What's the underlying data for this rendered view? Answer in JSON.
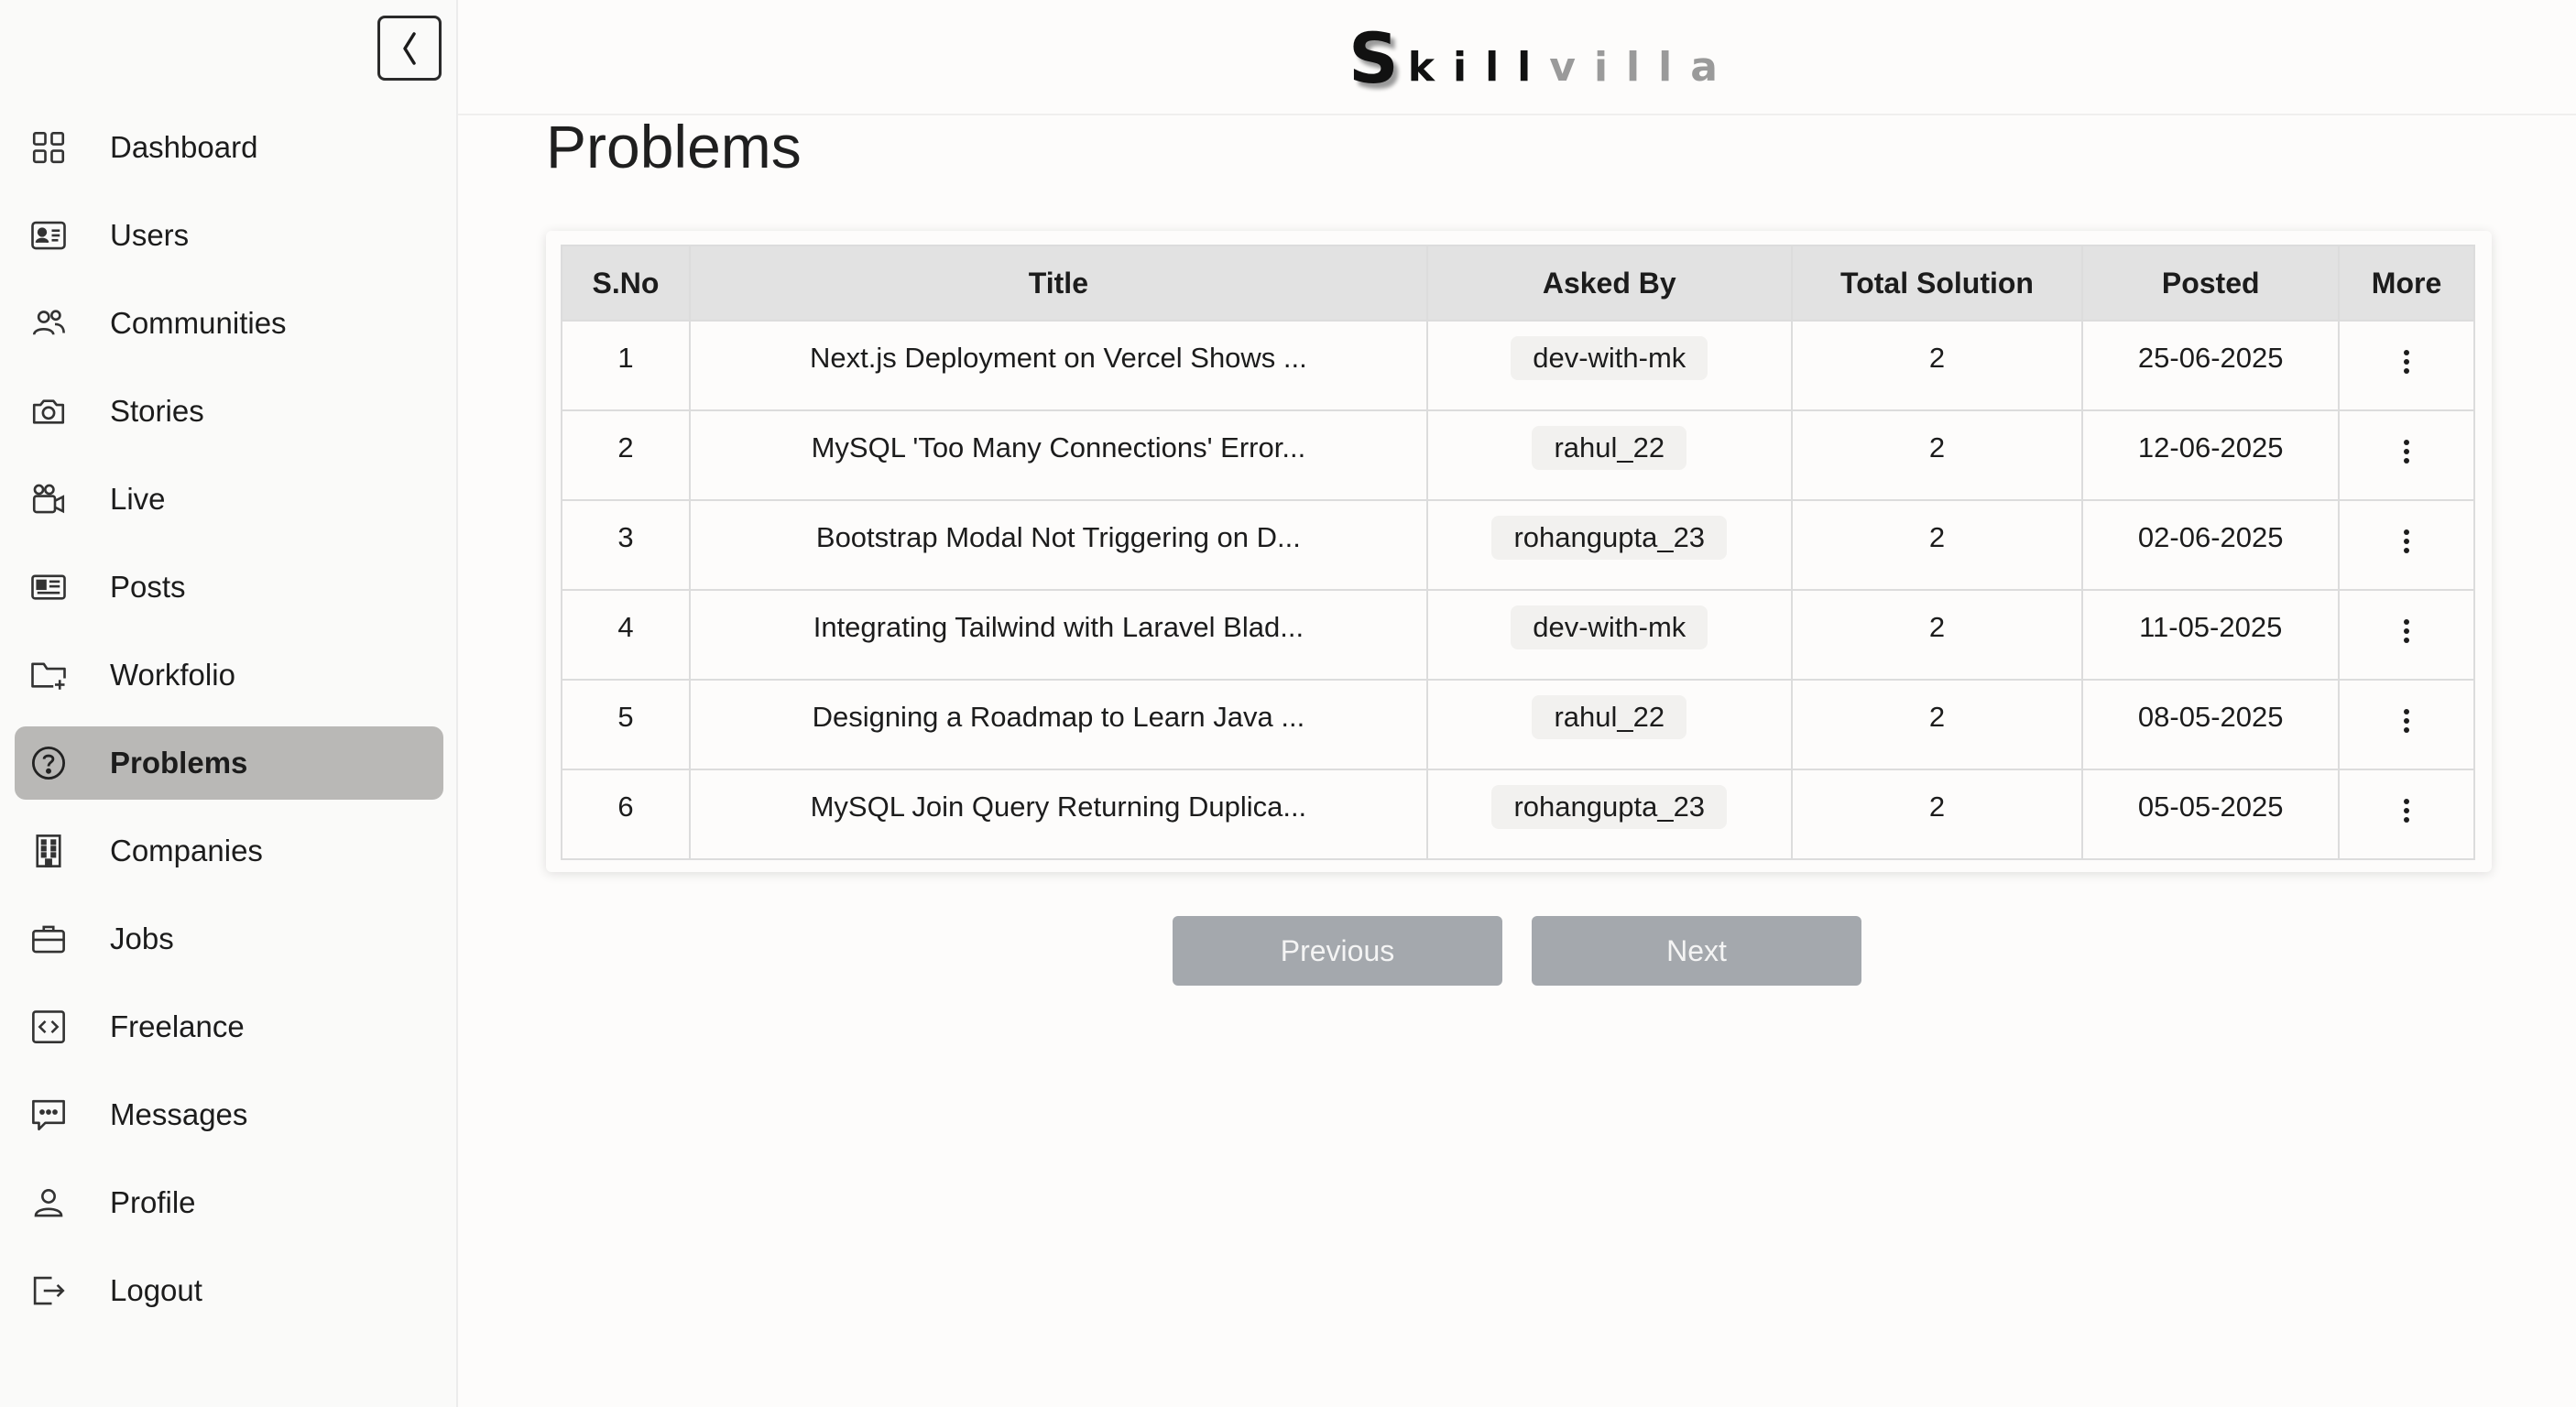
{
  "app": {
    "logo_initial": "S",
    "logo_dark": "kill",
    "logo_light": "villa"
  },
  "sidebar": {
    "items": [
      {
        "label": "Dashboard",
        "icon": "dashboard-grid-icon"
      },
      {
        "label": "Users",
        "icon": "id-card-icon"
      },
      {
        "label": "Communities",
        "icon": "users-group-icon"
      },
      {
        "label": "Stories",
        "icon": "camera-icon"
      },
      {
        "label": "Live",
        "icon": "video-camera-icon"
      },
      {
        "label": "Posts",
        "icon": "news-icon"
      },
      {
        "label": "Workfolio",
        "icon": "folder-plus-icon"
      },
      {
        "label": "Problems",
        "icon": "question-circle-icon",
        "active": true
      },
      {
        "label": "Companies",
        "icon": "building-icon"
      },
      {
        "label": "Jobs",
        "icon": "briefcase-icon"
      },
      {
        "label": "Freelance",
        "icon": "code-icon"
      },
      {
        "label": "Messages",
        "icon": "message-icon"
      },
      {
        "label": "Profile",
        "icon": "user-icon"
      },
      {
        "label": "Logout",
        "icon": "logout-icon"
      }
    ]
  },
  "main": {
    "title": "Problems",
    "table": {
      "headers": [
        "S.No",
        "Title",
        "Asked By",
        "Total Solution",
        "Posted",
        "More"
      ],
      "rows": [
        {
          "sno": "1",
          "title": "Next.js Deployment on Vercel Shows ...",
          "asked_by": "dev-with-mk",
          "total_solution": "2",
          "posted": "25-06-2025"
        },
        {
          "sno": "2",
          "title": "MySQL 'Too Many Connections' Error...",
          "asked_by": "rahul_22",
          "total_solution": "2",
          "posted": "12-06-2025"
        },
        {
          "sno": "3",
          "title": "Bootstrap Modal Not Triggering on D...",
          "asked_by": "rohangupta_23",
          "total_solution": "2",
          "posted": "02-06-2025"
        },
        {
          "sno": "4",
          "title": "Integrating Tailwind with Laravel Blad...",
          "asked_by": "dev-with-mk",
          "total_solution": "2",
          "posted": "11-05-2025"
        },
        {
          "sno": "5",
          "title": "Designing a Roadmap to Learn Java ...",
          "asked_by": "rahul_22",
          "total_solution": "2",
          "posted": "08-05-2025"
        },
        {
          "sno": "6",
          "title": "MySQL Join Query Returning Duplica...",
          "asked_by": "rohangupta_23",
          "total_solution": "2",
          "posted": "05-05-2025"
        }
      ]
    },
    "pagination": {
      "previous_label": "Previous",
      "next_label": "Next"
    }
  },
  "colors": {
    "active_nav_bg": "#b9b8b6",
    "table_header_bg": "#e2e2e2",
    "pager_button_bg": "#a4a8ad"
  }
}
